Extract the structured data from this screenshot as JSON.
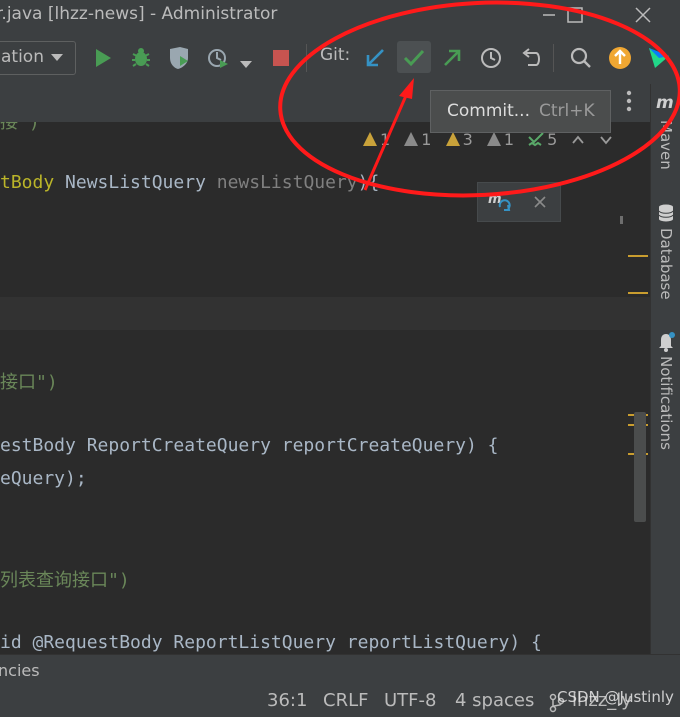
{
  "window": {
    "title": "r.java [lhzz-news] - Administrator"
  },
  "toolbar": {
    "run_config_label": "ation",
    "git_label": "Git:"
  },
  "tooltip": {
    "label": "Commit...",
    "shortcut": "Ctrl+K"
  },
  "inspections": [
    {
      "kind": "error",
      "count": "1",
      "color": "#c9a23a"
    },
    {
      "kind": "warning-gray",
      "count": "1",
      "color": "#8a8a8a"
    },
    {
      "kind": "warning",
      "count": "3",
      "color": "#c9a23a"
    },
    {
      "kind": "weak-warning",
      "count": "1",
      "color": "#8a8a8a"
    },
    {
      "kind": "typo",
      "count": "5",
      "color": "#59a869"
    }
  ],
  "code": {
    "line1": "接\")",
    "line2_kw": "tBody",
    "line2_type": " NewsListQuery ",
    "line2_param": "newsListQuery",
    "line2_end": "){",
    "line3": "接口\")",
    "line4": "estBody ReportCreateQuery reportCreateQuery) {",
    "line5": "eQuery);",
    "line6": "列表查询接口\")",
    "line7": "id @RequestBody ReportListQuery reportListQuery) {"
  },
  "rightbar": {
    "maven": "Maven",
    "database": "Database",
    "notifications": "Notifications"
  },
  "statusbar": {
    "left": "ncies",
    "position": "36:1",
    "line_sep": "CRLF",
    "encoding": "UTF-8",
    "indent": "4 spaces",
    "branch": "lhzz_ly",
    "watermark": "CSDN @Justinly"
  },
  "colors": {
    "annotation_red": "#ff1a1a",
    "run_green": "#499c54",
    "stop_red": "#c75450",
    "update_blue": "#3592c4"
  }
}
